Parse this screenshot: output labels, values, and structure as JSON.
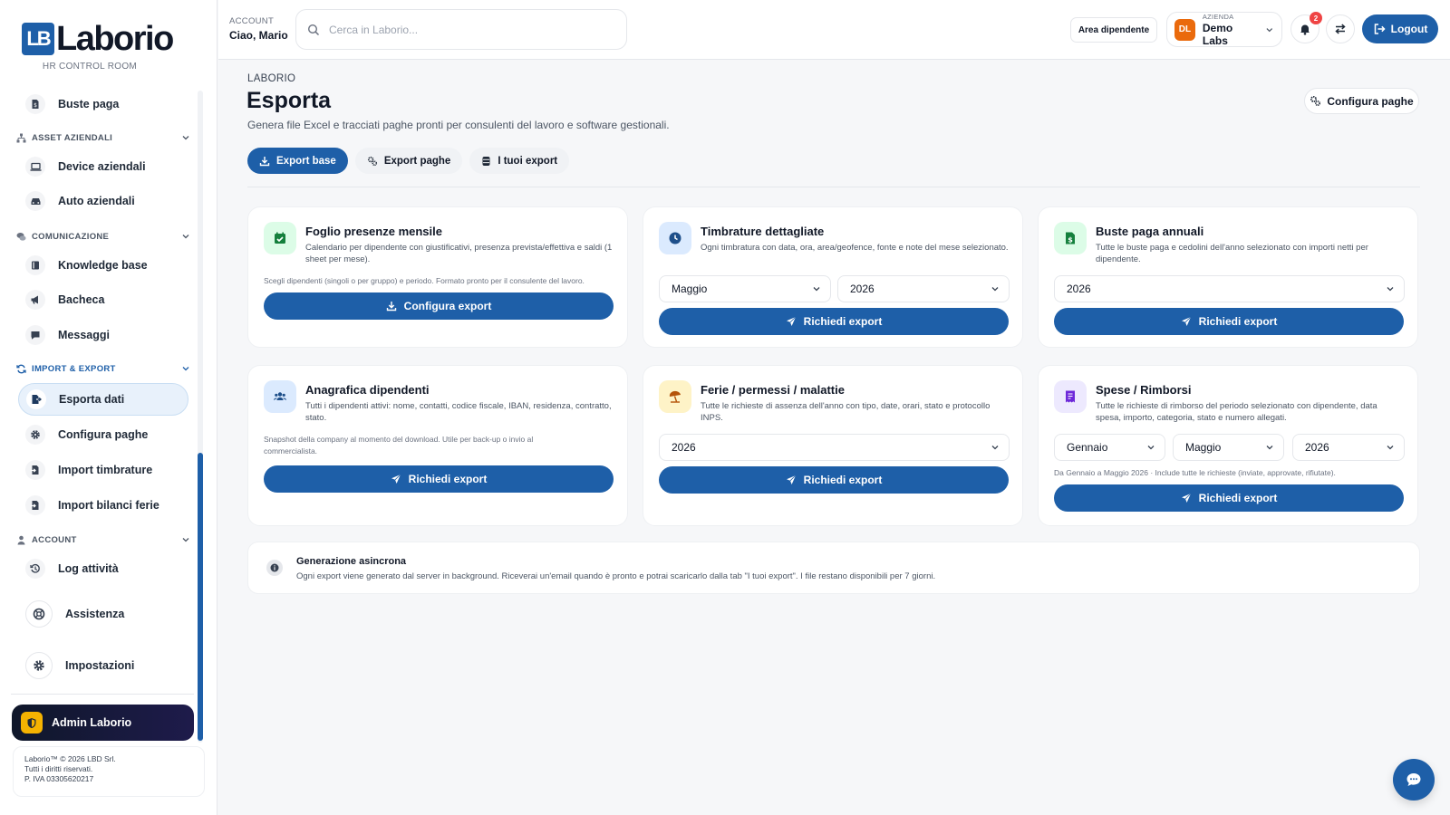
{
  "brand": {
    "mark": "LB",
    "name": "Laborio",
    "subtitle": "HR CONTROL ROOM"
  },
  "sidebar": {
    "items": {
      "buste_paga": "Buste paga",
      "device": "Device aziendali",
      "auto": "Auto aziendali",
      "knowledge": "Knowledge base",
      "bacheca": "Bacheca",
      "messaggi": "Messaggi",
      "esporta": "Esporta dati",
      "configura": "Configura paghe",
      "import_timbrature": "Import timbrature",
      "import_ferie": "Import bilanci ferie",
      "log": "Log attività",
      "assistenza": "Assistenza",
      "impostazioni": "Impostazioni"
    },
    "sections": {
      "asset": "ASSET AZIENDALI",
      "comunicazione": "COMUNICAZIONE",
      "import_export": "IMPORT & EXPORT",
      "account": "ACCOUNT"
    },
    "admin_label": "Admin Laborio",
    "footer": {
      "line1": "Laborio™ © 2026 LBD Srl.",
      "line2": "Tutti i diritti riservati.",
      "line3": "P. IVA 03305620217"
    }
  },
  "topbar": {
    "account_label": "ACCOUNT",
    "account_name": "Ciao, Mario",
    "search_placeholder": "Cerca in Laborio...",
    "area_button": "Area dipendente",
    "company_label": "AZIENDA",
    "company_name": "Demo Labs",
    "company_initials": "DL",
    "notification_count": "2",
    "logout": "Logout"
  },
  "page": {
    "breadcrumb": "LABORIO",
    "title": "Esporta",
    "description": "Genera file Excel e tracciati paghe pronti per consulenti del lavoro e software gestionali.",
    "config_button": "Configura paghe",
    "tabs": [
      "Export base",
      "Export paghe",
      "I tuoi export"
    ]
  },
  "cards": {
    "presenze": {
      "title": "Foglio presenze mensile",
      "desc": "Calendario per dipendente con giustificativi, presenza prevista/effettiva e saldi (1 sheet per mese).",
      "note": "Scegli dipendenti (singoli o per gruppo) e periodo. Formato pronto per il consulente del lavoro.",
      "button": "Configura export"
    },
    "timbrature": {
      "title": "Timbrature dettagliate",
      "desc": "Ogni timbratura con data, ora, area/geofence, fonte e note del mese selezionato.",
      "month": "Maggio",
      "year": "2026",
      "button": "Richiedi export"
    },
    "buste": {
      "title": "Buste paga annuali",
      "desc": "Tutte le buste paga e cedolini dell'anno selezionato con importi netti per dipendente.",
      "year": "2026",
      "button": "Richiedi export"
    },
    "anagrafica": {
      "title": "Anagrafica dipendenti",
      "desc": "Tutti i dipendenti attivi: nome, contatti, codice fiscale, IBAN, residenza, contratto, stato.",
      "note": "Snapshot della company al momento del download. Utile per back-up o invio al commercialista.",
      "button": "Richiedi export"
    },
    "ferie": {
      "title": "Ferie / permessi / malattie",
      "desc": "Tutte le richieste di assenza dell'anno con tipo, date, orari, stato e protocollo INPS.",
      "year": "2026",
      "button": "Richiedi export"
    },
    "spese": {
      "title": "Spese / Rimborsi",
      "desc": "Tutte le richieste di rimborso del periodo selezionato con dipendente, data spesa, importo, categoria, stato e numero allegati.",
      "from": "Gennaio",
      "to": "Maggio",
      "year": "2026",
      "note": "Da Gennaio a Maggio 2026 · Include tutte le richieste (inviate, approvate, rifiutate).",
      "button": "Richiedi export"
    }
  },
  "info": {
    "title": "Generazione asincrona",
    "desc": "Ogni export viene generato dal server in background. Riceverai un'email quando è pronto e potrai scaricarlo dalla tab \"I tuoi export\". I file restano disponibili per 7 giorni."
  },
  "colors": {
    "primary": "#1e5fa8",
    "accent_orange": "#ea6a0c",
    "badge_red": "#ef4444",
    "admin_gold": "#f5b301"
  }
}
